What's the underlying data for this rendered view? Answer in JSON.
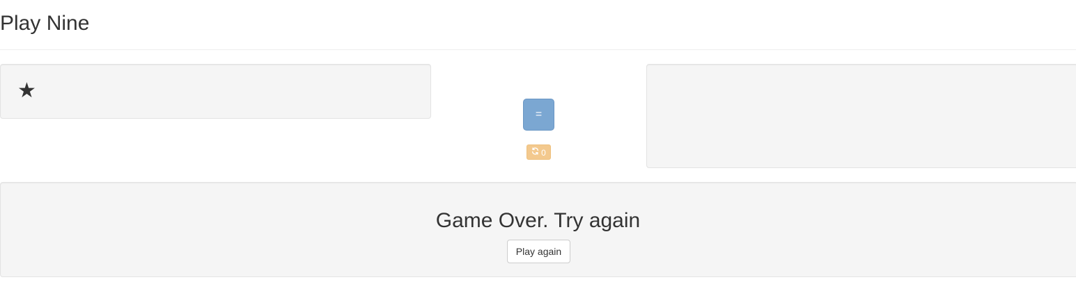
{
  "header": {
    "title": "Play Nine"
  },
  "stars_frame": {
    "star_count": 1,
    "star_glyph": "★"
  },
  "controls": {
    "equals_label": "=",
    "redraw_count": "0",
    "equals_color": "#7ba7d2",
    "redraw_color": "#f3c98e"
  },
  "answer_frame": {
    "selected_numbers": []
  },
  "result": {
    "message": "Game Over. Try again",
    "play_again_label": "Play again"
  }
}
